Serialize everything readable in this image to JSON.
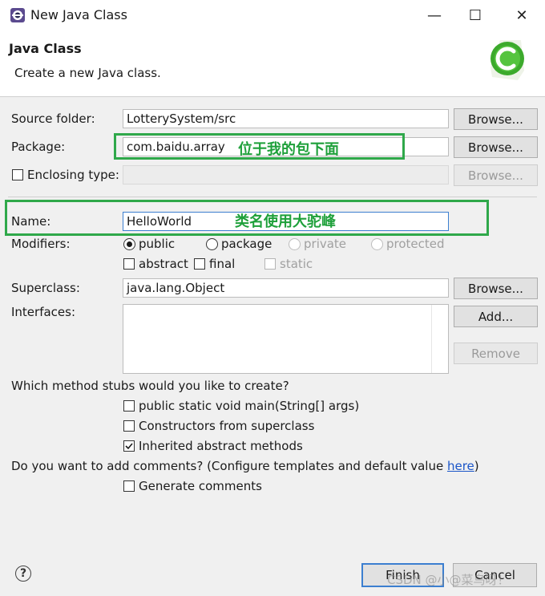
{
  "window": {
    "title": "New Java Class",
    "controls": {
      "minimize": "—",
      "maximize": "☐",
      "close": "✕"
    }
  },
  "header": {
    "title": "Java Class",
    "description": "Create a new Java class.",
    "icon": "java-class-wizard-icon"
  },
  "form": {
    "source_folder": {
      "label": "Source folder:",
      "value": "LotterySystem/src",
      "button": "Browse..."
    },
    "package": {
      "label": "Package:",
      "value": "com.baidu.array",
      "button": "Browse...",
      "annotation": "位于我的包下面"
    },
    "enclosing_type": {
      "label": "Enclosing type:",
      "value": "",
      "button": "Browse...",
      "checked": false
    },
    "name": {
      "label": "Name:",
      "value": "HelloWorld",
      "annotation": "类名使用大驼峰"
    },
    "modifiers": {
      "label": "Modifiers:",
      "access": [
        {
          "label": "public",
          "selected": true,
          "enabled": true
        },
        {
          "label": "package",
          "selected": false,
          "enabled": true
        },
        {
          "label": "private",
          "selected": false,
          "enabled": false
        },
        {
          "label": "protected",
          "selected": false,
          "enabled": false
        }
      ],
      "other": [
        {
          "label": "abstract",
          "checked": false,
          "enabled": true
        },
        {
          "label": "final",
          "checked": false,
          "enabled": true
        },
        {
          "label": "static",
          "checked": false,
          "enabled": false
        }
      ]
    },
    "superclass": {
      "label": "Superclass:",
      "value": "java.lang.Object",
      "button": "Browse..."
    },
    "interfaces": {
      "label": "Interfaces:",
      "add_button": "Add...",
      "remove_button": "Remove"
    }
  },
  "stubs": {
    "question": "Which method stubs would you like to create?",
    "options": [
      {
        "label": "public static void main(String[] args)",
        "checked": false
      },
      {
        "label": "Constructors from superclass",
        "checked": false
      },
      {
        "label": "Inherited abstract methods",
        "checked": true
      }
    ]
  },
  "comments": {
    "question_prefix": "Do you want to add comments? (Configure templates and default value ",
    "link": "here",
    "question_suffix": ")",
    "option": {
      "label": "Generate comments",
      "checked": false
    }
  },
  "footer": {
    "help": "?",
    "finish": "Finish",
    "cancel": "Cancel",
    "watermark": "CSDN @小@菜鸟呀！"
  },
  "colors": {
    "annotation": "#2fa84a",
    "link": "#1a55c8",
    "accent": "#3c7fd0"
  }
}
